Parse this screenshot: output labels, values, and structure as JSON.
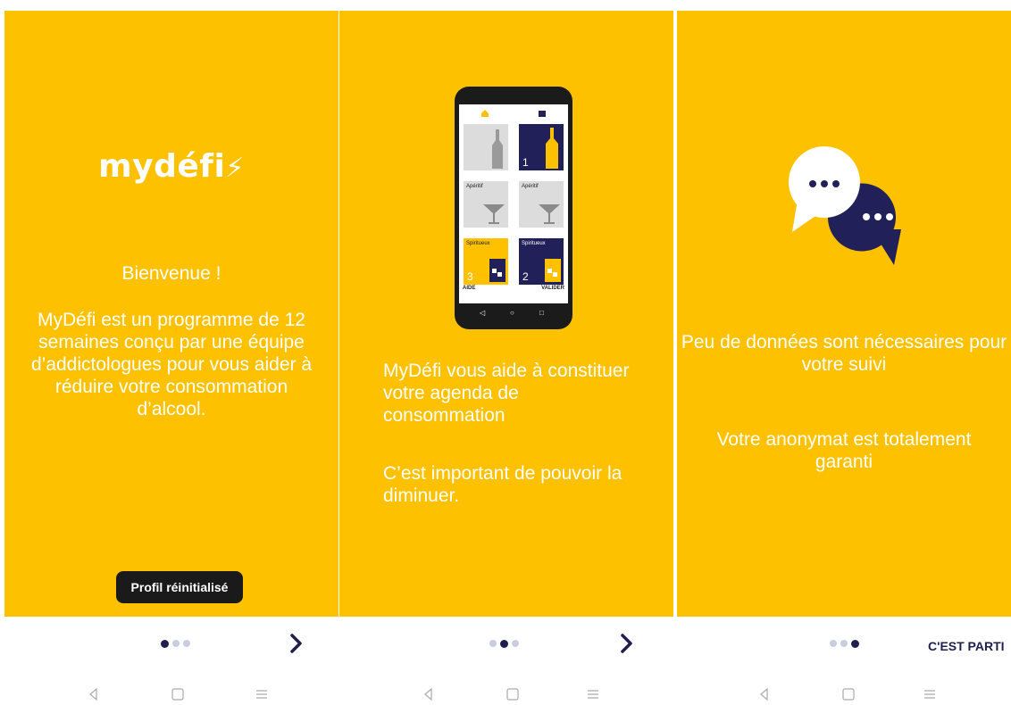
{
  "panels": [
    {
      "logo": "mydéfi",
      "title": "Bienvenue !",
      "body": "MyDéfi est un programme de 12 semaines conçu par une équipe d’addictologues pour vous aider à réduire votre consommation d’alcool.",
      "toast": "Profil réinitialisé",
      "active_dot": 0
    },
    {
      "text1": "MyDéfi vous aide à constituer votre agenda de consommation",
      "text2": "C’est important de pouvoir la diminuer.",
      "active_dot": 1,
      "phone": {
        "tiles": [
          {
            "label": "",
            "num": ""
          },
          {
            "label": "",
            "num": "1"
          },
          {
            "label": "Apéritif",
            "num": ""
          },
          {
            "label": "Apéritif",
            "num": ""
          },
          {
            "label": "Spiritueux",
            "num": "3"
          },
          {
            "label": "Spiritueux",
            "num": "2"
          }
        ],
        "aide": "AIDE",
        "valider": "VALIDER"
      }
    },
    {
      "text1": "Peu de données sont nécessaires pour votre suivi",
      "text2": "Votre anonymat est totalement garanti",
      "active_dot": 2,
      "cta": "C'EST PARTI"
    }
  ],
  "colors": {
    "brand_yellow": "#FDC100",
    "navy": "#222058"
  }
}
